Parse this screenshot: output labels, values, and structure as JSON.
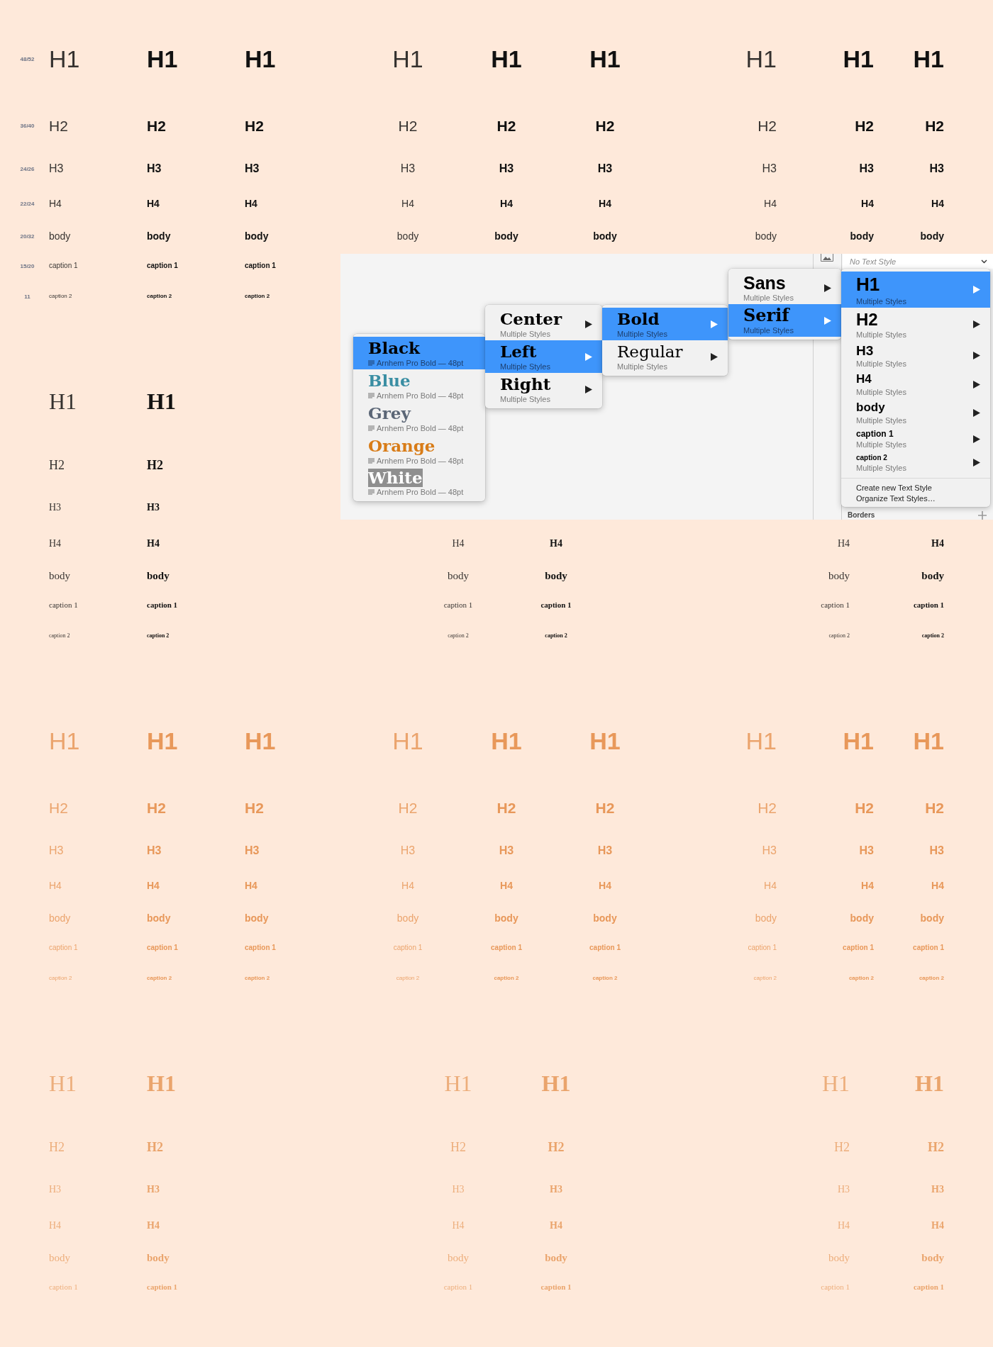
{
  "sections": [
    {
      "kind": "sans",
      "color": "#111111",
      "rows": [
        {
          "kind": "h1",
          "size": "48/52",
          "groups": [
            {
              "kind": "left",
              "cells": [
                {
                  "kind": "light",
                  "text": "H1"
                },
                {
                  "kind": "semibold",
                  "text": "H1"
                },
                {
                  "kind": "bold",
                  "text": "H1"
                }
              ]
            },
            {
              "kind": "center",
              "cells": [
                {
                  "kind": "light",
                  "text": "H1"
                },
                {
                  "kind": "semibold",
                  "text": "H1"
                },
                {
                  "kind": "bold",
                  "text": "H1"
                }
              ]
            },
            {
              "kind": "right",
              "cells": [
                {
                  "kind": "light",
                  "text": "H1"
                },
                {
                  "kind": "semibold",
                  "text": "H1"
                },
                {
                  "kind": "bold",
                  "text": "H1"
                }
              ]
            }
          ]
        },
        {
          "kind": "h2",
          "size": "36/40",
          "groups": [
            {
              "kind": "left",
              "cells": [
                {
                  "kind": "light",
                  "text": "H2"
                },
                {
                  "kind": "semibold",
                  "text": "H2"
                },
                {
                  "kind": "bold",
                  "text": "H2"
                }
              ]
            },
            {
              "kind": "center",
              "cells": [
                {
                  "kind": "light",
                  "text": "H2"
                },
                {
                  "kind": "semibold",
                  "text": "H2"
                },
                {
                  "kind": "bold",
                  "text": "H2"
                }
              ]
            },
            {
              "kind": "right",
              "cells": [
                {
                  "kind": "light",
                  "text": "H2"
                },
                {
                  "kind": "semibold",
                  "text": "H2"
                },
                {
                  "kind": "bold",
                  "text": "H2"
                }
              ]
            }
          ]
        },
        {
          "kind": "h3",
          "size": "24/26",
          "groups": [
            {
              "kind": "left",
              "cells": [
                {
                  "kind": "light",
                  "text": "H3"
                },
                {
                  "kind": "semibold",
                  "text": "H3"
                },
                {
                  "kind": "bold",
                  "text": "H3"
                }
              ]
            },
            {
              "kind": "center",
              "cells": [
                {
                  "kind": "light",
                  "text": "H3"
                },
                {
                  "kind": "semibold",
                  "text": "H3"
                },
                {
                  "kind": "bold",
                  "text": "H3"
                }
              ]
            },
            {
              "kind": "right",
              "cells": [
                {
                  "kind": "light",
                  "text": "H3"
                },
                {
                  "kind": "semibold",
                  "text": "H3"
                },
                {
                  "kind": "bold",
                  "text": "H3"
                }
              ]
            }
          ]
        },
        {
          "kind": "h4",
          "size": "22/24",
          "groups": [
            {
              "kind": "left",
              "cells": [
                {
                  "kind": "light",
                  "text": "H4"
                },
                {
                  "kind": "semibold",
                  "text": "H4"
                },
                {
                  "kind": "bold",
                  "text": "H4"
                }
              ]
            },
            {
              "kind": "center",
              "cells": [
                {
                  "kind": "light",
                  "text": "H4"
                },
                {
                  "kind": "semibold",
                  "text": "H4"
                },
                {
                  "kind": "bold",
                  "text": "H4"
                }
              ]
            },
            {
              "kind": "right",
              "cells": [
                {
                  "kind": "light",
                  "text": "H4"
                },
                {
                  "kind": "semibold",
                  "text": "H4"
                },
                {
                  "kind": "bold",
                  "text": "H4"
                }
              ]
            }
          ]
        },
        {
          "kind": "body",
          "size": "20/32",
          "groups": [
            {
              "kind": "left",
              "cells": [
                {
                  "kind": "light",
                  "text": "body"
                },
                {
                  "kind": "semibold",
                  "text": "body"
                },
                {
                  "kind": "bold",
                  "text": "body"
                }
              ]
            },
            {
              "kind": "center",
              "cells": [
                {
                  "kind": "light",
                  "text": "body"
                },
                {
                  "kind": "semibold",
                  "text": "body"
                },
                {
                  "kind": "bold",
                  "text": "body"
                }
              ]
            },
            {
              "kind": "right",
              "cells": [
                {
                  "kind": "light",
                  "text": "body"
                },
                {
                  "kind": "semibold",
                  "text": "body"
                },
                {
                  "kind": "bold",
                  "text": "body"
                }
              ]
            }
          ]
        },
        {
          "kind": "caption1",
          "size": "15/20",
          "groups": [
            {
              "kind": "left",
              "cells": [
                {
                  "kind": "light",
                  "text": "caption 1"
                },
                {
                  "kind": "semibold",
                  "text": "caption 1"
                },
                {
                  "kind": "bold",
                  "text": "caption 1"
                }
              ]
            }
          ]
        },
        {
          "kind": "caption2",
          "size": "11",
          "groups": [
            {
              "kind": "left",
              "cells": [
                {
                  "kind": "light",
                  "text": "caption 2"
                },
                {
                  "kind": "semibold",
                  "text": "caption 2"
                },
                {
                  "kind": "bold",
                  "text": "caption 2"
                }
              ]
            }
          ]
        }
      ]
    },
    {
      "kind": "serif",
      "color": "#111111",
      "rows": [
        {
          "kind": "h1",
          "groups": [
            {
              "kind": "left",
              "cells": [
                {
                  "kind": "regular",
                  "text": "H1"
                },
                {
                  "kind": "bold",
                  "text": "H1"
                }
              ]
            }
          ]
        },
        {
          "kind": "h2",
          "groups": [
            {
              "kind": "left",
              "cells": [
                {
                  "kind": "regular",
                  "text": "H2"
                },
                {
                  "kind": "bold",
                  "text": "H2"
                }
              ]
            }
          ]
        },
        {
          "kind": "h3",
          "groups": [
            {
              "kind": "left",
              "cells": [
                {
                  "kind": "regular",
                  "text": "H3"
                },
                {
                  "kind": "bold",
                  "text": "H3"
                }
              ]
            }
          ]
        },
        {
          "kind": "h4",
          "groups": [
            {
              "kind": "left",
              "cells": [
                {
                  "kind": "regular",
                  "text": "H4"
                },
                {
                  "kind": "bold",
                  "text": "H4"
                }
              ]
            },
            {
              "kind": "center",
              "cells": [
                {
                  "kind": "regular",
                  "text": "H4"
                },
                {
                  "kind": "bold",
                  "text": "H4"
                }
              ]
            },
            {
              "kind": "right",
              "cells": [
                {
                  "kind": "regular",
                  "text": "H4"
                },
                {
                  "kind": "bold",
                  "text": "H4"
                }
              ]
            }
          ]
        },
        {
          "kind": "body",
          "groups": [
            {
              "kind": "left",
              "cells": [
                {
                  "kind": "regular",
                  "text": "body"
                },
                {
                  "kind": "bold",
                  "text": "body"
                }
              ]
            },
            {
              "kind": "center",
              "cells": [
                {
                  "kind": "regular",
                  "text": "body"
                },
                {
                  "kind": "bold",
                  "text": "body"
                }
              ]
            },
            {
              "kind": "right",
              "cells": [
                {
                  "kind": "regular",
                  "text": "body"
                },
                {
                  "kind": "bold",
                  "text": "body"
                }
              ]
            }
          ]
        },
        {
          "kind": "caption1",
          "groups": [
            {
              "kind": "left",
              "cells": [
                {
                  "kind": "regular",
                  "text": "caption 1"
                },
                {
                  "kind": "bold",
                  "text": "caption 1"
                }
              ]
            },
            {
              "kind": "center",
              "cells": [
                {
                  "kind": "regular",
                  "text": "caption 1"
                },
                {
                  "kind": "bold",
                  "text": "caption 1"
                }
              ]
            },
            {
              "kind": "right",
              "cells": [
                {
                  "kind": "regular",
                  "text": "caption 1"
                },
                {
                  "kind": "bold",
                  "text": "caption 1"
                }
              ]
            }
          ]
        },
        {
          "kind": "caption2",
          "groups": [
            {
              "kind": "left",
              "cells": [
                {
                  "kind": "regular",
                  "text": "caption 2"
                },
                {
                  "kind": "bold",
                  "text": "caption 2"
                }
              ]
            },
            {
              "kind": "center",
              "cells": [
                {
                  "kind": "regular",
                  "text": "caption 2"
                },
                {
                  "kind": "bold",
                  "text": "caption 2"
                }
              ]
            },
            {
              "kind": "right",
              "cells": [
                {
                  "kind": "regular",
                  "text": "caption 2"
                },
                {
                  "kind": "bold",
                  "text": "caption 2"
                }
              ]
            }
          ]
        }
      ]
    },
    {
      "kind": "sans",
      "color": "#e8985a",
      "rows": [
        {
          "kind": "h1",
          "groups": [
            {
              "kind": "left",
              "cells": [
                {
                  "kind": "light",
                  "text": "H1"
                },
                {
                  "kind": "semibold",
                  "text": "H1"
                },
                {
                  "kind": "bold",
                  "text": "H1"
                }
              ]
            },
            {
              "kind": "center",
              "cells": [
                {
                  "kind": "light",
                  "text": "H1"
                },
                {
                  "kind": "semibold",
                  "text": "H1"
                },
                {
                  "kind": "bold",
                  "text": "H1"
                }
              ]
            },
            {
              "kind": "right",
              "cells": [
                {
                  "kind": "light",
                  "text": "H1"
                },
                {
                  "kind": "semibold",
                  "text": "H1"
                },
                {
                  "kind": "bold",
                  "text": "H1"
                }
              ]
            }
          ]
        },
        {
          "kind": "h2",
          "groups": [
            {
              "kind": "left",
              "cells": [
                {
                  "kind": "light",
                  "text": "H2"
                },
                {
                  "kind": "semibold",
                  "text": "H2"
                },
                {
                  "kind": "bold",
                  "text": "H2"
                }
              ]
            },
            {
              "kind": "center",
              "cells": [
                {
                  "kind": "light",
                  "text": "H2"
                },
                {
                  "kind": "semibold",
                  "text": "H2"
                },
                {
                  "kind": "bold",
                  "text": "H2"
                }
              ]
            },
            {
              "kind": "right",
              "cells": [
                {
                  "kind": "light",
                  "text": "H2"
                },
                {
                  "kind": "semibold",
                  "text": "H2"
                },
                {
                  "kind": "bold",
                  "text": "H2"
                }
              ]
            }
          ]
        },
        {
          "kind": "h3",
          "groups": [
            {
              "kind": "left",
              "cells": [
                {
                  "kind": "light",
                  "text": "H3"
                },
                {
                  "kind": "semibold",
                  "text": "H3"
                },
                {
                  "kind": "bold",
                  "text": "H3"
                }
              ]
            },
            {
              "kind": "center",
              "cells": [
                {
                  "kind": "light",
                  "text": "H3"
                },
                {
                  "kind": "semibold",
                  "text": "H3"
                },
                {
                  "kind": "bold",
                  "text": "H3"
                }
              ]
            },
            {
              "kind": "right",
              "cells": [
                {
                  "kind": "light",
                  "text": "H3"
                },
                {
                  "kind": "semibold",
                  "text": "H3"
                },
                {
                  "kind": "bold",
                  "text": "H3"
                }
              ]
            }
          ]
        },
        {
          "kind": "h4",
          "groups": [
            {
              "kind": "left",
              "cells": [
                {
                  "kind": "light",
                  "text": "H4"
                },
                {
                  "kind": "semibold",
                  "text": "H4"
                },
                {
                  "kind": "bold",
                  "text": "H4"
                }
              ]
            },
            {
              "kind": "center",
              "cells": [
                {
                  "kind": "light",
                  "text": "H4"
                },
                {
                  "kind": "semibold",
                  "text": "H4"
                },
                {
                  "kind": "bold",
                  "text": "H4"
                }
              ]
            },
            {
              "kind": "right",
              "cells": [
                {
                  "kind": "light",
                  "text": "H4"
                },
                {
                  "kind": "semibold",
                  "text": "H4"
                },
                {
                  "kind": "bold",
                  "text": "H4"
                }
              ]
            }
          ]
        },
        {
          "kind": "body",
          "groups": [
            {
              "kind": "left",
              "cells": [
                {
                  "kind": "light",
                  "text": "body"
                },
                {
                  "kind": "semibold",
                  "text": "body"
                },
                {
                  "kind": "bold",
                  "text": "body"
                }
              ]
            },
            {
              "kind": "center",
              "cells": [
                {
                  "kind": "light",
                  "text": "body"
                },
                {
                  "kind": "semibold",
                  "text": "body"
                },
                {
                  "kind": "bold",
                  "text": "body"
                }
              ]
            },
            {
              "kind": "right",
              "cells": [
                {
                  "kind": "light",
                  "text": "body"
                },
                {
                  "kind": "semibold",
                  "text": "body"
                },
                {
                  "kind": "bold",
                  "text": "body"
                }
              ]
            }
          ]
        },
        {
          "kind": "caption1",
          "groups": [
            {
              "kind": "left",
              "cells": [
                {
                  "kind": "light",
                  "text": "caption 1"
                },
                {
                  "kind": "semibold",
                  "text": "caption 1"
                },
                {
                  "kind": "bold",
                  "text": "caption 1"
                }
              ]
            },
            {
              "kind": "center",
              "cells": [
                {
                  "kind": "light",
                  "text": "caption 1"
                },
                {
                  "kind": "semibold",
                  "text": "caption 1"
                },
                {
                  "kind": "bold",
                  "text": "caption 1"
                }
              ]
            },
            {
              "kind": "right",
              "cells": [
                {
                  "kind": "light",
                  "text": "caption 1"
                },
                {
                  "kind": "semibold",
                  "text": "caption 1"
                },
                {
                  "kind": "bold",
                  "text": "caption 1"
                }
              ]
            }
          ]
        },
        {
          "kind": "caption2",
          "groups": [
            {
              "kind": "left",
              "cells": [
                {
                  "kind": "light",
                  "text": "caption 2"
                },
                {
                  "kind": "semibold",
                  "text": "caption 2"
                },
                {
                  "kind": "bold",
                  "text": "caption 2"
                }
              ]
            },
            {
              "kind": "center",
              "cells": [
                {
                  "kind": "light",
                  "text": "caption 2"
                },
                {
                  "kind": "semibold",
                  "text": "caption 2"
                },
                {
                  "kind": "bold",
                  "text": "caption 2"
                }
              ]
            },
            {
              "kind": "right",
              "cells": [
                {
                  "kind": "light",
                  "text": "caption 2"
                },
                {
                  "kind": "semibold",
                  "text": "caption 2"
                },
                {
                  "kind": "bold",
                  "text": "caption 2"
                }
              ]
            }
          ]
        }
      ]
    },
    {
      "kind": "serif",
      "color": "#eaa46c",
      "rows": [
        {
          "kind": "h1",
          "groups": [
            {
              "kind": "left",
              "cells": [
                {
                  "kind": "regular",
                  "text": "H1"
                },
                {
                  "kind": "bold",
                  "text": "H1"
                }
              ]
            },
            {
              "kind": "center",
              "cells": [
                {
                  "kind": "regular",
                  "text": "H1"
                },
                {
                  "kind": "bold",
                  "text": "H1"
                }
              ]
            },
            {
              "kind": "right",
              "cells": [
                {
                  "kind": "regular",
                  "text": "H1"
                },
                {
                  "kind": "bold",
                  "text": "H1"
                }
              ]
            }
          ]
        },
        {
          "kind": "h2",
          "groups": [
            {
              "kind": "left",
              "cells": [
                {
                  "kind": "regular",
                  "text": "H2"
                },
                {
                  "kind": "bold",
                  "text": "H2"
                }
              ]
            },
            {
              "kind": "center",
              "cells": [
                {
                  "kind": "regular",
                  "text": "H2"
                },
                {
                  "kind": "bold",
                  "text": "H2"
                }
              ]
            },
            {
              "kind": "right",
              "cells": [
                {
                  "kind": "regular",
                  "text": "H2"
                },
                {
                  "kind": "bold",
                  "text": "H2"
                }
              ]
            }
          ]
        },
        {
          "kind": "h3",
          "groups": [
            {
              "kind": "left",
              "cells": [
                {
                  "kind": "regular",
                  "text": "H3"
                },
                {
                  "kind": "bold",
                  "text": "H3"
                }
              ]
            },
            {
              "kind": "center",
              "cells": [
                {
                  "kind": "regular",
                  "text": "H3"
                },
                {
                  "kind": "bold",
                  "text": "H3"
                }
              ]
            },
            {
              "kind": "right",
              "cells": [
                {
                  "kind": "regular",
                  "text": "H3"
                },
                {
                  "kind": "bold",
                  "text": "H3"
                }
              ]
            }
          ]
        },
        {
          "kind": "h4",
          "groups": [
            {
              "kind": "left",
              "cells": [
                {
                  "kind": "regular",
                  "text": "H4"
                },
                {
                  "kind": "bold",
                  "text": "H4"
                }
              ]
            },
            {
              "kind": "center",
              "cells": [
                {
                  "kind": "regular",
                  "text": "H4"
                },
                {
                  "kind": "bold",
                  "text": "H4"
                }
              ]
            },
            {
              "kind": "right",
              "cells": [
                {
                  "kind": "regular",
                  "text": "H4"
                },
                {
                  "kind": "bold",
                  "text": "H4"
                }
              ]
            }
          ]
        },
        {
          "kind": "body",
          "groups": [
            {
              "kind": "left",
              "cells": [
                {
                  "kind": "regular",
                  "text": "body"
                },
                {
                  "kind": "bold",
                  "text": "body"
                }
              ]
            },
            {
              "kind": "center",
              "cells": [
                {
                  "kind": "regular",
                  "text": "body"
                },
                {
                  "kind": "bold",
                  "text": "body"
                }
              ]
            },
            {
              "kind": "right",
              "cells": [
                {
                  "kind": "regular",
                  "text": "body"
                },
                {
                  "kind": "bold",
                  "text": "body"
                }
              ]
            }
          ]
        },
        {
          "kind": "caption1",
          "groups": [
            {
              "kind": "left",
              "cells": [
                {
                  "kind": "regular",
                  "text": "caption 1"
                },
                {
                  "kind": "bold",
                  "text": "caption 1"
                }
              ]
            },
            {
              "kind": "center",
              "cells": [
                {
                  "kind": "regular",
                  "text": "caption 1"
                },
                {
                  "kind": "bold",
                  "text": "caption 1"
                }
              ]
            },
            {
              "kind": "right",
              "cells": [
                {
                  "kind": "regular",
                  "text": "caption 1"
                },
                {
                  "kind": "bold",
                  "text": "caption 1"
                }
              ]
            }
          ]
        }
      ]
    }
  ],
  "screenshot": {
    "style_field": {
      "value": "No Text Style"
    },
    "section_label": "Borders",
    "menus": [
      {
        "kind": "color",
        "items": [
          {
            "title": "Black",
            "subtitle": "Arnhem Pro Bold — 48pt",
            "color": "#000000",
            "highlighted": false,
            "selected": true
          },
          {
            "title": "Blue",
            "subtitle": "Arnhem Pro Bold — 48pt",
            "color": "#3a8ea3",
            "highlighted": false,
            "selected": false
          },
          {
            "title": "Grey",
            "subtitle": "Arnhem Pro Bold — 48pt",
            "color": "#5b6676",
            "highlighted": false,
            "selected": false
          },
          {
            "title": "Orange",
            "subtitle": "Arnhem Pro Bold — 48pt",
            "color": "#d87c18",
            "highlighted": false,
            "selected": false
          },
          {
            "title": "White",
            "subtitle": "Arnhem Pro Bold — 48pt",
            "highlighted": true,
            "selected": false
          }
        ]
      },
      {
        "kind": "alignment",
        "items": [
          {
            "title": "Center",
            "subtitle": "Multiple Styles",
            "selected": false
          },
          {
            "title": "Left",
            "subtitle": "Multiple Styles",
            "selected": true
          },
          {
            "title": "Right",
            "subtitle": "Multiple Styles",
            "selected": false
          }
        ]
      },
      {
        "kind": "weight",
        "items": [
          {
            "title": "Bold",
            "subtitle": "Multiple Styles",
            "selected": true
          },
          {
            "title": "Regular",
            "subtitle": "Multiple Styles",
            "selected": false
          }
        ]
      },
      {
        "kind": "family",
        "items": [
          {
            "kind": "sans",
            "title": "Sans",
            "subtitle": "Multiple Styles",
            "selected": false
          },
          {
            "kind": "serif",
            "title": "Serif",
            "subtitle": "Multiple Styles",
            "selected": true
          }
        ]
      },
      {
        "kind": "style",
        "items": [
          {
            "kind": "h1",
            "title": "H1",
            "subtitle": "Multiple Styles",
            "selected": true
          },
          {
            "kind": "h2",
            "title": "H2",
            "subtitle": "Multiple Styles",
            "selected": false
          },
          {
            "kind": "h3",
            "title": "H3",
            "subtitle": "Multiple Styles",
            "selected": false
          },
          {
            "kind": "h4",
            "title": "H4",
            "subtitle": "Multiple Styles",
            "selected": false
          },
          {
            "kind": "body",
            "title": "body",
            "subtitle": "Multiple Styles",
            "selected": false
          },
          {
            "kind": "caption1",
            "title": "caption 1",
            "subtitle": "Multiple Styles",
            "selected": false
          },
          {
            "kind": "caption2",
            "title": "caption 2",
            "subtitle": "Multiple Styles",
            "selected": false
          }
        ],
        "actions": [
          "Create new Text Style",
          "Organize Text Styles…"
        ]
      }
    ]
  }
}
